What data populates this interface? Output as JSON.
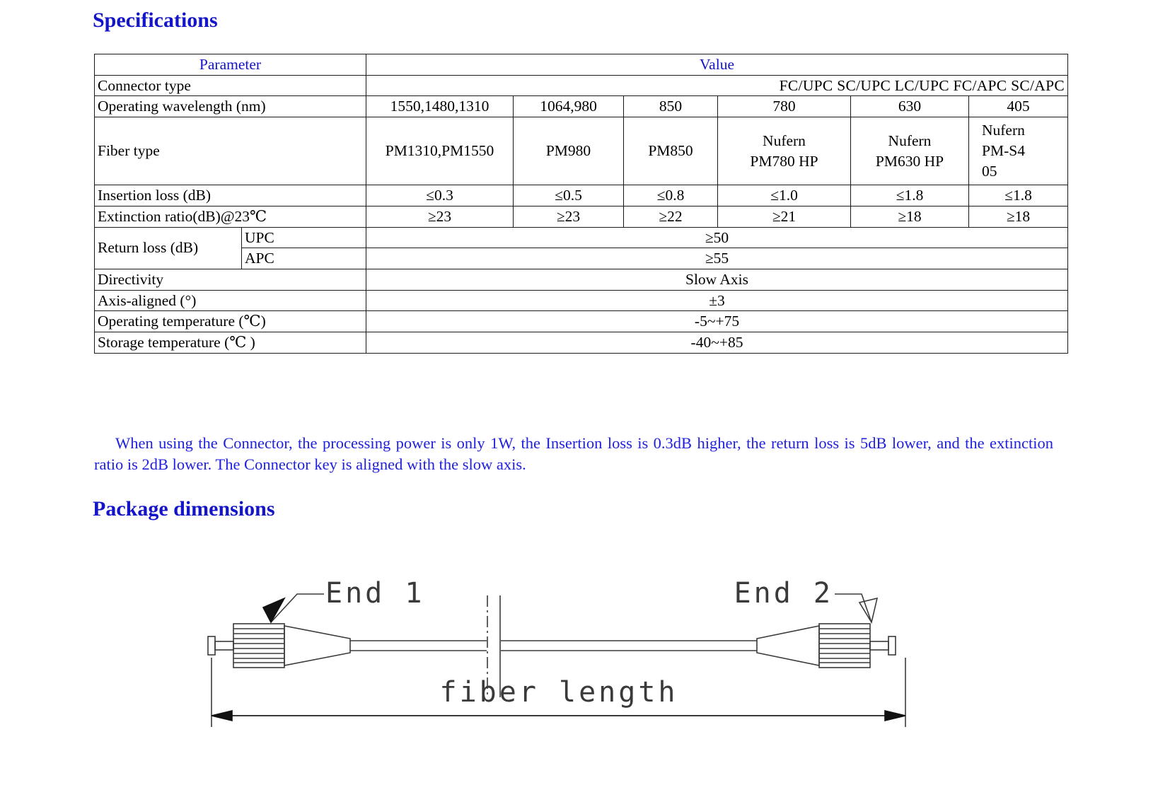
{
  "headings": {
    "specifications": "Specifications",
    "package_dimensions": "Package dimensions"
  },
  "table": {
    "header": {
      "parameter": "Parameter",
      "value": "Value"
    },
    "rows": {
      "connector_type": {
        "label": "Connector type",
        "value": "FC/UPC   SC/UPC   LC/UPC   FC/APC   SC/APC"
      },
      "operating_wavelength": {
        "label": "Operating wavelength (nm)",
        "values": [
          "1550,1480,1310",
          "1064,980",
          "850",
          "780",
          "630",
          "405"
        ]
      },
      "fiber_type": {
        "label": "Fiber type",
        "values": [
          "PM1310,PM1550",
          "PM980",
          "PM850",
          "Nufern\nPM780 HP",
          "Nufern\nPM630 HP",
          "Nufern\nPM-S4\n05"
        ]
      },
      "insertion_loss": {
        "label": "Insertion loss (dB)",
        "values": [
          "≤0.3",
          "≤0.5",
          "≤0.8",
          "≤1.0",
          "≤1.8",
          "≤1.8"
        ]
      },
      "extinction_ratio": {
        "label": "Extinction ratio(dB)@23℃",
        "values": [
          "≥23",
          "≥23",
          "≥22",
          "≥21",
          "≥18",
          "≥18"
        ]
      },
      "return_loss": {
        "label": "Return loss  (dB)",
        "sub": [
          {
            "label": "UPC",
            "value": "≥50"
          },
          {
            "label": "APC",
            "value": "≥55"
          }
        ]
      },
      "directivity": {
        "label": "Directivity",
        "value": "Slow Axis"
      },
      "axis_aligned": {
        "label": "Axis-aligned (°)",
        "value": "±3"
      },
      "operating_temperature": {
        "label": "Operating temperature (℃)",
        "value": "-5~+75"
      },
      "storage_temperature": {
        "label": "Storage temperature (℃ )",
        "value": "-40~+85"
      }
    }
  },
  "note": "When using the Connector, the processing power is only 1W, the Insertion loss is 0.3dB higher, the return loss is 5dB lower, and the extinction ratio is 2dB lower. The Connector key is aligned with the slow axis.",
  "drawing": {
    "end1_label": "End 1",
    "end2_label": "End 2",
    "fiber_length_label": "fiber length"
  },
  "colors": {
    "heading_blue": "#1414c8",
    "note_blue": "#2020dd",
    "table_border": "#1a1a1a",
    "drawing_line": "#3a3a3a"
  }
}
